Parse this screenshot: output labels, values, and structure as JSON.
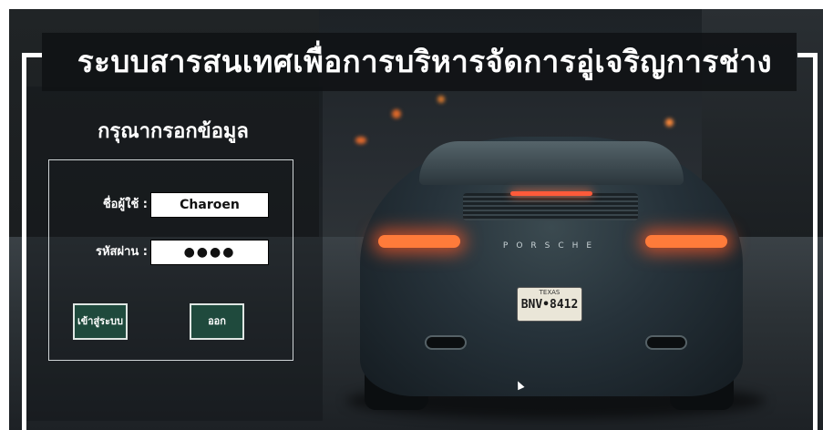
{
  "app": {
    "title": "ระบบสารสนเทศเพื่อการบริหารจัดการอู่เจริญการช่าง"
  },
  "login_form": {
    "heading": "กรุณากรอกข้อมูล",
    "username_label": "ชื่อผู้ใช้ :",
    "username_value": "Charoen",
    "password_label": "รหัสผ่าน :",
    "password_value": "●●●●",
    "login_button": "เข้าสู่ระบบ",
    "exit_button": "ออก"
  },
  "background": {
    "car_brand": "PORSCHE",
    "plate_state": "TEXAS",
    "plate_number": "BNV•8412"
  },
  "colors": {
    "button_bg": "#1f4a3d",
    "taillight": "#ff7b3a"
  }
}
